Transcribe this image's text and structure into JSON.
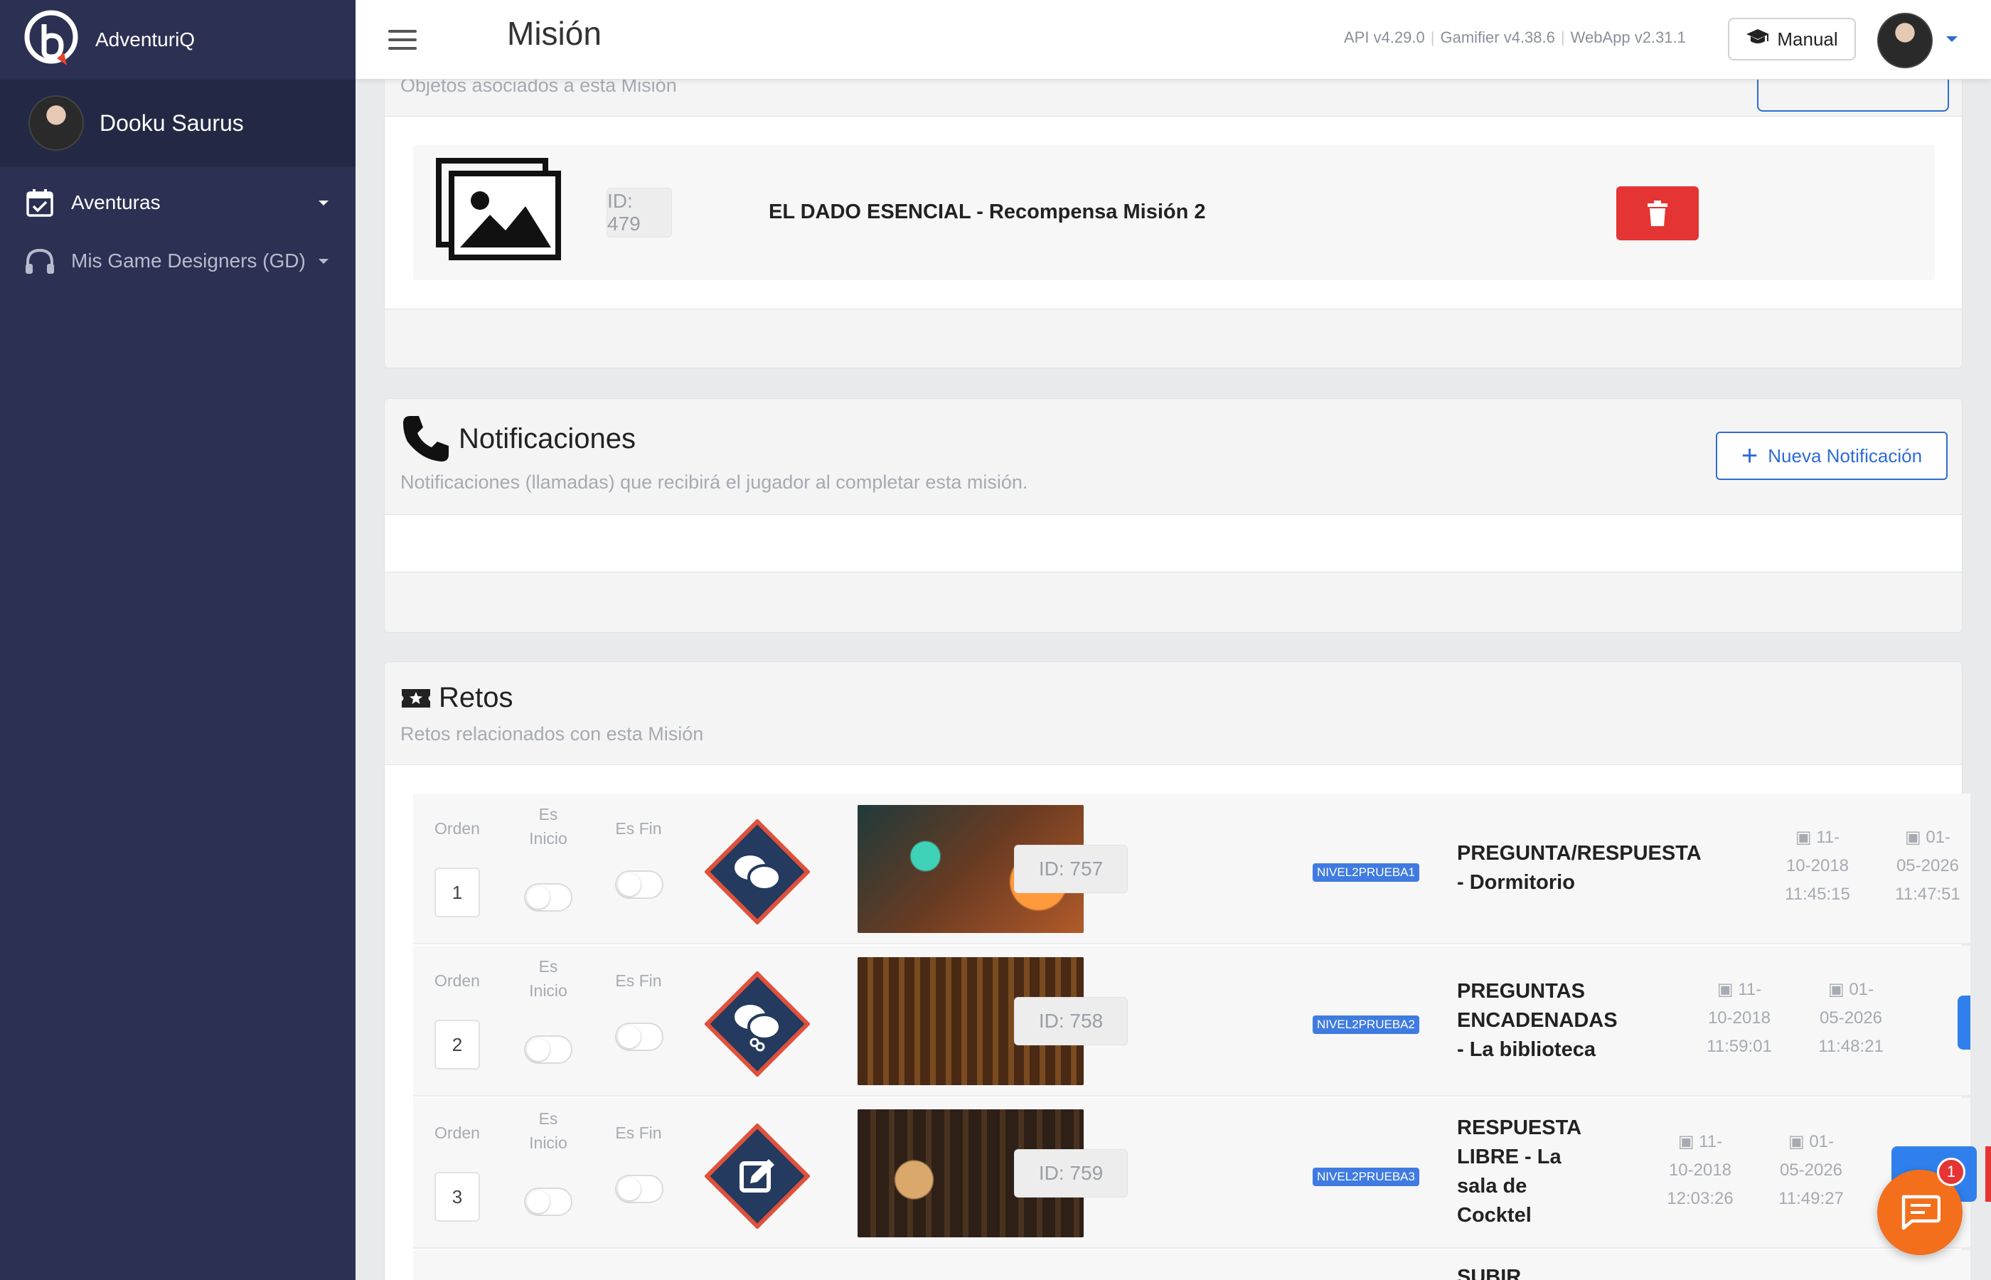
{
  "brand": {
    "name": "AdventuriQ"
  },
  "user": {
    "name": "Dooku Saurus"
  },
  "sidebar": {
    "items": [
      {
        "label": "Aventuras",
        "icon": "calendar-check-icon"
      },
      {
        "label": "Mis Game Designers (GD)",
        "icon": "headphones-icon"
      }
    ]
  },
  "header": {
    "title": "Misión",
    "versions": [
      "API v4.29.0",
      "Gamifier v4.38.6",
      "WebApp v2.31.1"
    ],
    "manual_label": "Manual"
  },
  "objects": {
    "subtitle": "Objetos asociados a esta Misión",
    "items": [
      {
        "id_label": "ID: 479",
        "name": "EL DADO ESENCIAL - Recompensa Misión 2"
      }
    ]
  },
  "notifications": {
    "title": "Notificaciones",
    "subtitle": "Notificaciones (llamadas) que recibirá el jugador al completar esta misión.",
    "new_button": "Nueva Notificación"
  },
  "retos": {
    "title": "Retos",
    "subtitle": "Retos relacionados con esta Misión",
    "labels": {
      "orden": "Orden",
      "es_inicio": "Es Inicio",
      "es_fin": "Es Fin"
    },
    "rows": [
      {
        "order": "1",
        "id_label": "ID: 757",
        "tag": "NIVEL2PRUEBA1",
        "title_lines": [
          "PREGUNTA/RESPUESTA",
          "- Dormitorio"
        ],
        "created": [
          "11-",
          "10-2018",
          "11:45:15"
        ],
        "updated": [
          "01-",
          "05-2026",
          "11:47:51"
        ],
        "icon": "chat-bubbles-icon"
      },
      {
        "order": "2",
        "id_label": "ID: 758",
        "tag": "NIVEL2PRUEBA2",
        "title_lines": [
          "PREGUNTAS",
          "ENCADENADAS",
          "- La biblioteca"
        ],
        "created": [
          "11-",
          "10-2018",
          "11:59:01"
        ],
        "updated": [
          "01-",
          "05-2026",
          "11:48:21"
        ],
        "icon": "chained-chat-icon"
      },
      {
        "order": "3",
        "id_label": "ID: 759",
        "tag": "NIVEL2PRUEBA3",
        "title_lines": [
          "RESPUESTA",
          "LIBRE - La",
          "sala de",
          "Cocktel"
        ],
        "created": [
          "11-",
          "10-2018",
          "12:03:26"
        ],
        "updated": [
          "01-",
          "05-2026",
          "11:49:27"
        ],
        "icon": "edit-note-icon"
      }
    ],
    "next_row_title": "SUBIR"
  },
  "chat": {
    "badge": "1"
  },
  "colors": {
    "sidebar": "#2c3153",
    "accent": "#2f6bd6",
    "danger": "#e53434",
    "chat": "#f36f1c"
  }
}
